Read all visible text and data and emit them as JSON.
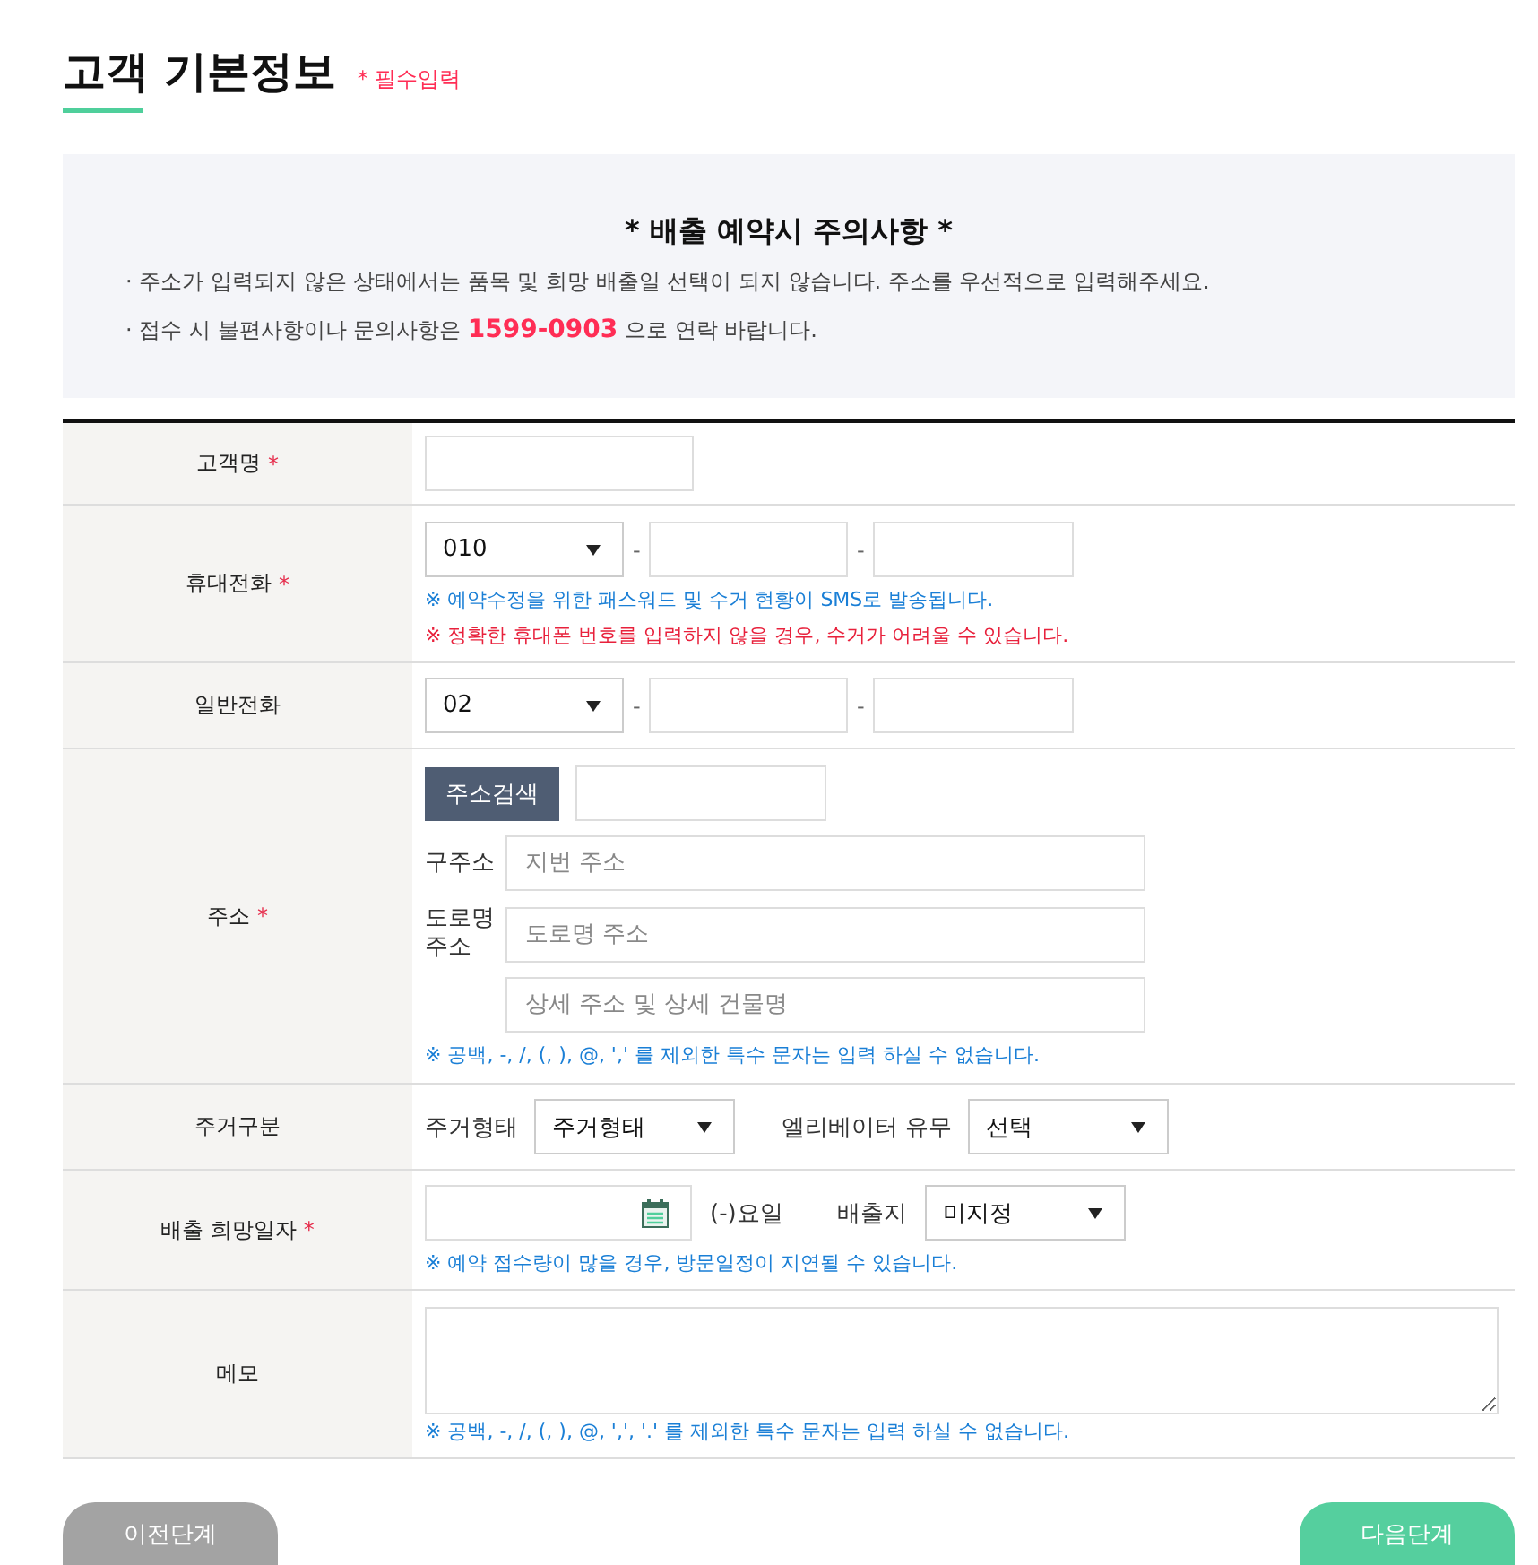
{
  "header": {
    "title": "고객 기본정보",
    "required_note": "* 필수입력"
  },
  "notice": {
    "title": "* 배출 예약시 주의사항 *",
    "items": [
      "· 주소가 입력되지 않은 상태에서는 품목 및 희망 배출일 선택이 되지 않습니다. 주소를 우선적으로 입력해주세요.",
      "· 접수 시 불편사항이나 문의사항은 **1599-0903** 으로 연락 바랍니다."
    ]
  },
  "form": {
    "rows": [
      {
        "kind": "text",
        "label": "고객명",
        "mark": "*"
      },
      {
        "kind": "phone",
        "label": "휴대전화",
        "mark": "*",
        "select": "010",
        "separators": [
          "-",
          "-"
        ],
        "notes": [
          {
            "kind": "info",
            "text": "※ 예약수정을 위한 패스워드 및 수거 현황이 SMS로 발송됩니다."
          },
          {
            "kind": "warning",
            "text": "※ 정확한 휴대폰 번호를 입력하지 않을 경우, 수거가 어려울 수 있습니다."
          }
        ]
      },
      {
        "kind": "phone",
        "label": "일반전화",
        "select": "02",
        "separators": [
          "-",
          "-"
        ]
      },
      {
        "kind": "address",
        "label": "주소",
        "mark": "*",
        "button": "주소검색",
        "lines": [
          {
            "label": "구주소",
            "placeholder": "지번 주소"
          },
          {
            "label": "도로명 주소",
            "placeholder": "도로명 주소"
          },
          {
            "placeholder": "상세 주소 및 상세 건물명"
          }
        ],
        "notes": [
          {
            "kind": "info",
            "text": "※ 공백, -, /, (, ), @, ',' 를 제외한 특수 문자는 입력 하실 수 없습니다."
          }
        ]
      },
      {
        "kind": "residence",
        "label": "주거구분",
        "options": [
          {
            "label": "주거형태",
            "select": "주거형태"
          },
          {
            "label": "엘리베이터 유무",
            "select": "선택"
          }
        ]
      },
      {
        "kind": "date",
        "label": "배출 희망일자",
        "mark": "*",
        "weekday": "(-)요일",
        "place_label": "배출지",
        "select": "미지정",
        "notes": [
          {
            "kind": "info",
            "text": "※ 예약 접수량이 많을 경우, 방문일정이 지연될 수 있습니다."
          }
        ]
      },
      {
        "kind": "memo",
        "label": "메모",
        "notes": [
          {
            "kind": "info",
            "text": "※ 공백, -, /, (, ), @, ',', '.' 를 제외한 특수 문자는 입력 하실 수 없습니다."
          }
        ]
      }
    ]
  },
  "buttons": [
    {
      "kind": "prev",
      "label": "이전단계"
    },
    {
      "kind": "next",
      "label": "다음단계"
    }
  ]
}
